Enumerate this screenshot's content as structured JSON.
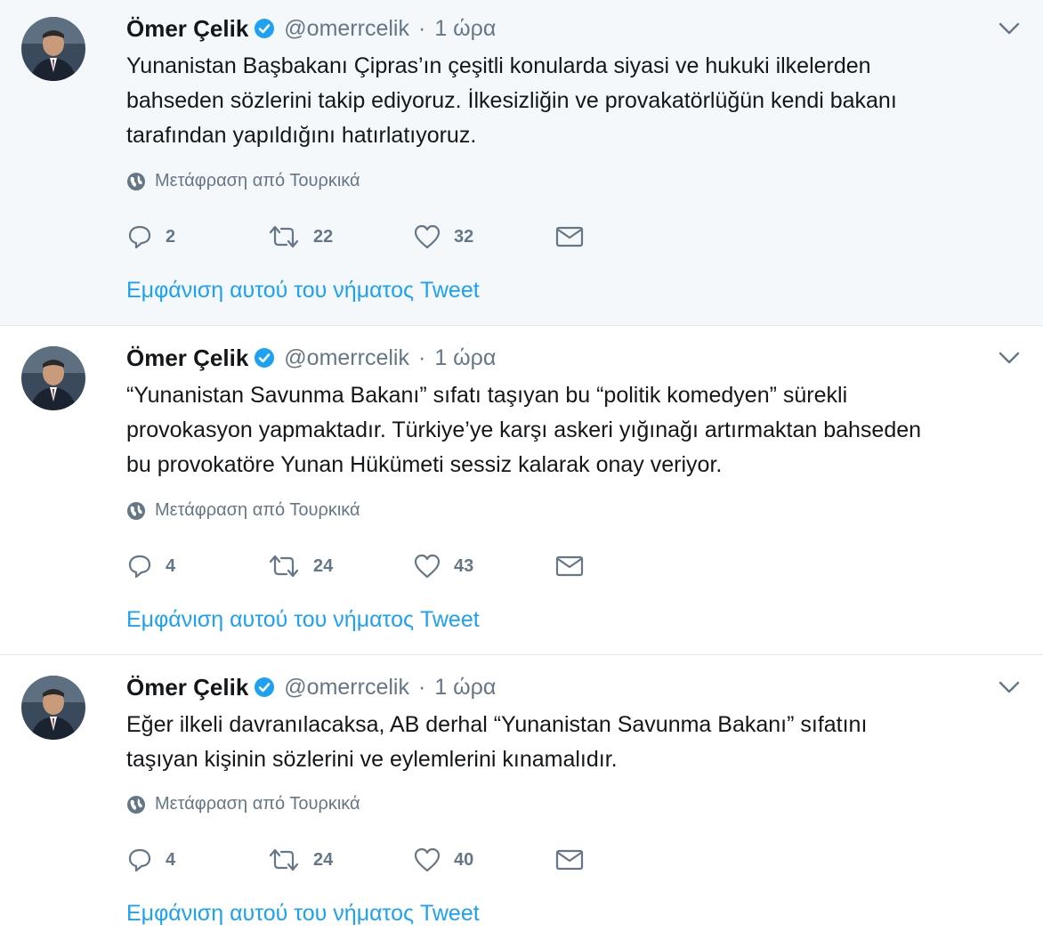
{
  "tweets": [
    {
      "author": {
        "name": "Ömer Çelik",
        "handle": "@omerrcelik",
        "separator": "·",
        "time": "1 ώρα"
      },
      "lines": [
        "Yunanistan Başbakanı Çipras’ın çeşitli konularda siyasi ve hukuki ilkelerden",
        "bahseden sözlerini takip ediyoruz. İlkesizliğin ve provakatörlüğün kendi bakanı",
        "tarafından yapıldığını hatırlatıyoruz."
      ],
      "translate": "Μετάφραση από Τουρκικά",
      "replies": "2",
      "retweets": "22",
      "likes": "32",
      "thread_link": "Εμφάνιση αυτού του νήματος Tweet"
    },
    {
      "author": {
        "name": "Ömer Çelik",
        "handle": "@omerrcelik",
        "separator": "·",
        "time": "1 ώρα"
      },
      "lines": [
        "“Yunanistan Savunma Bakanı” sıfatı taşıyan bu “politik komedyen” sürekli",
        "provokasyon yapmaktadır. Türkiye’ye karşı askeri yığınağı artırmaktan bahseden",
        "bu provokatöre Yunan Hükümeti sessiz kalarak onay veriyor."
      ],
      "translate": "Μετάφραση από Τουρκικά",
      "replies": "4",
      "retweets": "24",
      "likes": "43",
      "thread_link": "Εμφάνιση αυτού του νήματος Tweet"
    },
    {
      "author": {
        "name": "Ömer Çelik",
        "handle": "@omerrcelik",
        "separator": "·",
        "time": "1 ώρα"
      },
      "lines": [
        "Eğer ilkeli davranılacaksa, AB derhal “Yunanistan Savunma Bakanı” sıfatını",
        "taşıyan kişinin sözlerini ve eylemlerini kınamalıdır."
      ],
      "translate": "Μετάφραση από Τουρκικά",
      "replies": "4",
      "retweets": "24",
      "likes": "40",
      "thread_link": "Εμφάνιση αυτού του νήματος Tweet"
    }
  ],
  "icons": {
    "reply": "reply-icon",
    "retweet": "retweet-icon",
    "like": "heart-icon",
    "dm": "envelope-icon",
    "globe": "globe-icon",
    "verified": "verified-badge-icon",
    "caret": "chevron-down-icon"
  },
  "colors": {
    "link": "#1da1f2",
    "muted": "#657786",
    "text": "#14171a",
    "highlight_bg": "#f5f8fa",
    "border": "#e1e8ed"
  }
}
